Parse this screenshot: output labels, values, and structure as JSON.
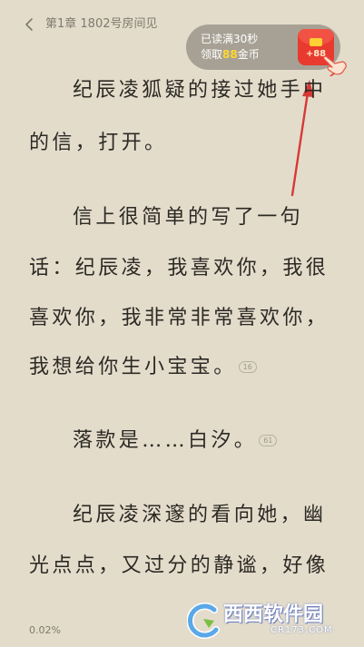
{
  "header": {
    "chapter_title": "第1章 1802号房间见"
  },
  "reward": {
    "line1": "已读满30秒",
    "line2_prefix": "领取",
    "amount": "88",
    "line2_suffix": "金币",
    "badge": "+88",
    "accent_color": "#e83a2e"
  },
  "content": {
    "paragraphs": [
      {
        "lines": [
          "纪辰凌狐疑的接过她手中",
          "的信，打开。"
        ]
      },
      {
        "lines": [
          "信上很简单的写了一句",
          "话：纪辰凌，我喜欢你，我很",
          "喜欢你，我非常非常喜欢你，",
          "我想给你生小宝宝。"
        ],
        "comment_count": "16"
      },
      {
        "lines": [
          "落款是……白汐。"
        ],
        "comment_count": "61"
      },
      {
        "lines": [
          "纪辰凌深邃的看向她，幽",
          "光点点，又过分的静谧，好像"
        ]
      }
    ]
  },
  "footer": {
    "progress": "0.02%"
  },
  "watermark": {
    "name": "西西软件园",
    "site": "CR173.COM"
  },
  "icons": {
    "back": "chevron-left-icon",
    "redpacket": "red-packet-icon",
    "hand": "pointing-hand-icon"
  }
}
